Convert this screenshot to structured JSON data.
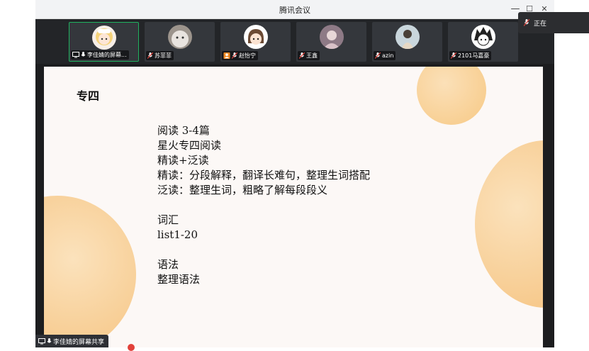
{
  "window": {
    "title": "腾讯会议",
    "controls": {
      "minimize": "—",
      "maximize": "☐",
      "close": "✕"
    }
  },
  "participants": [
    {
      "name": "李佳婧的屏幕...",
      "active": true,
      "sharing": true
    },
    {
      "name": "苏菲菲",
      "active": false,
      "sharing": false
    },
    {
      "name": "赵怡宁",
      "active": false,
      "sharing": false,
      "host_badge": true
    },
    {
      "name": "王鑫",
      "active": false,
      "sharing": false
    },
    {
      "name": "azin",
      "active": false,
      "sharing": false
    },
    {
      "name": "2101马嘉豪",
      "active": false,
      "sharing": false
    }
  ],
  "toast": {
    "text": "正在"
  },
  "slide": {
    "heading": "专四",
    "lines": [
      "阅读 3-4篇",
      "星火专四阅读",
      "精读+泛读",
      "精读：分段解释，翻译长难句，整理生词搭配",
      "泛读：整理生词，粗略了解每段段义",
      "",
      "词汇",
      "list1-20",
      "",
      "语法",
      "整理语法"
    ]
  },
  "share_bar": {
    "text": "李佳婧的屏幕共享"
  },
  "colors": {
    "accent_green": "#1fb15f",
    "slide_bg": "#fcf8f6",
    "circle_orange": "#f7c27a"
  }
}
